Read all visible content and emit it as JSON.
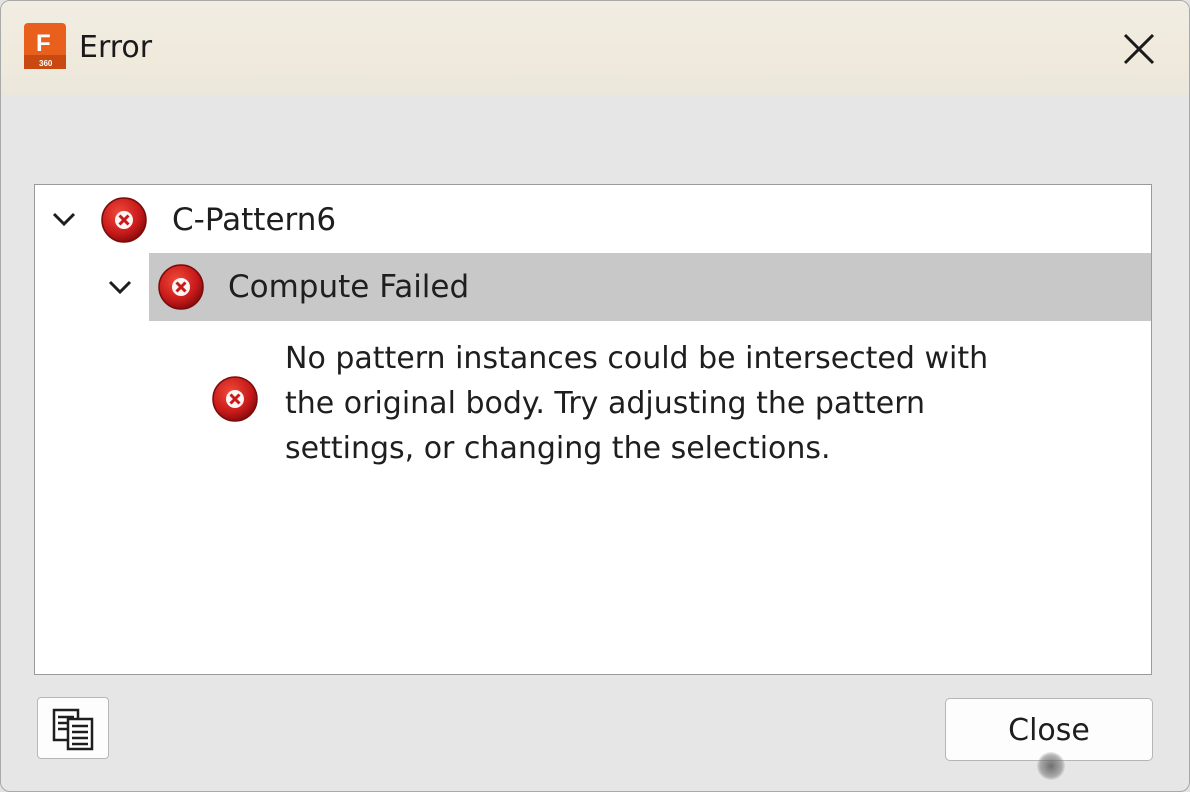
{
  "window": {
    "title": "Error",
    "app_icon": {
      "name": "fusion-360-icon",
      "letter": "F",
      "badge": "360",
      "color": "#e8601c"
    },
    "close_icon": "close-icon"
  },
  "tree": {
    "items": [
      {
        "label": "C-Pattern6",
        "icon": "error-icon",
        "expanded": true,
        "children": [
          {
            "label": "Compute Failed",
            "icon": "error-icon",
            "expanded": true,
            "selected": true,
            "message": {
              "icon": "error-icon",
              "lines": [
                "No pattern instances could be intersected with",
                "the original body. Try adjusting the pattern",
                "settings, or changing the selections."
              ]
            }
          }
        ]
      }
    ]
  },
  "footer": {
    "copy_icon": "copy-to-clipboard-icon",
    "close_label": "Close"
  },
  "colors": {
    "error_red": "#c81a1a",
    "selection_gray": "#c8c8c8",
    "titlebar": "#efeadc"
  }
}
